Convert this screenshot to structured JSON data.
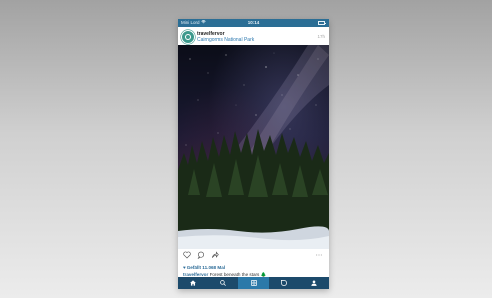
{
  "status_bar": {
    "carrier": "Mini Lord",
    "time": "10:14",
    "icons": [
      "wifi-icon",
      "battery-icon"
    ]
  },
  "post": {
    "username": "travelfervor",
    "location": "Cairngorms National Park",
    "time_ago": "17h",
    "photo": "night sky with milky way over pine forest and snow",
    "likes": "Gefällt 11.068 Mal",
    "caption_user": "travelfervor",
    "caption_text": "Forest beneath the stars 🌲"
  },
  "actions": [
    "heart-icon",
    "comment-icon",
    "share-icon",
    "more-icon"
  ],
  "tab_bar": {
    "tabs": [
      "home-icon",
      "search-icon",
      "camera-icon",
      "activity-icon",
      "profile-icon"
    ],
    "active": "camera-icon"
  },
  "colors": {
    "accent": "#2b79a9",
    "tab_bar": "#1c4a6b",
    "link": "#2e7ab0"
  }
}
